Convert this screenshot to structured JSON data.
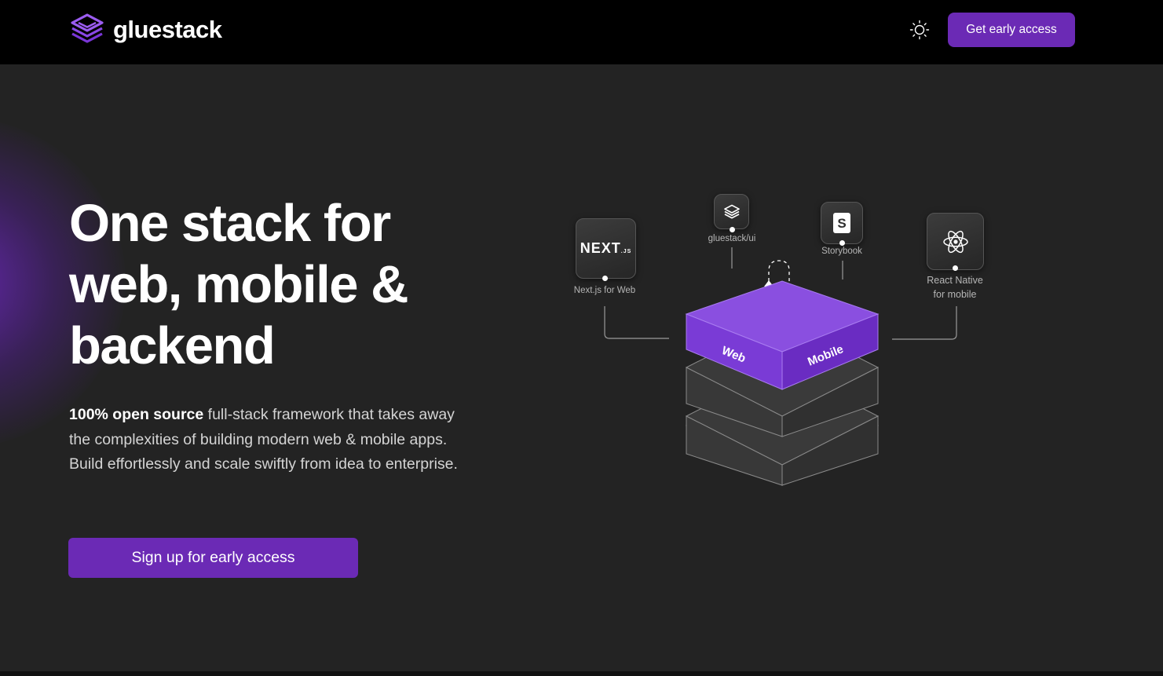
{
  "header": {
    "brand_name": "gluestack",
    "cta_label": "Get early access",
    "theme_icon": "sun-icon",
    "colors": {
      "background": "#000000",
      "accent": "#6b2ab5"
    }
  },
  "hero": {
    "headline_lines": [
      "One stack for",
      "web, mobile &",
      "backend"
    ],
    "description_bold": "100% open source",
    "description_rest": " full-stack framework that takes away the complexities of building modern web & mobile apps. Build effortlessly and scale swiftly from idea to enterprise.",
    "cta_label": "Sign up for early access"
  },
  "illustration": {
    "tiles": [
      {
        "id": "nextjs",
        "logo_text": "NEXT",
        "logo_sub": ".JS",
        "label": "Next.js for Web",
        "icon": "nextjs-logo-icon"
      },
      {
        "id": "gluestack-ui",
        "label": "gluestack/ui",
        "icon": "gluestack-logo-icon"
      },
      {
        "id": "storybook",
        "logo_text": "S",
        "label": "Storybook",
        "icon": "storybook-logo-icon"
      },
      {
        "id": "react-native",
        "label_lines": [
          "React Native",
          "for mobile"
        ],
        "icon": "react-logo-icon"
      }
    ],
    "cube_labels": {
      "left": "Web",
      "right": "Mobile"
    },
    "colors": {
      "top_layer": "#8a4fe0",
      "top_layer_side_left": "#7a3bd6",
      "top_layer_side_right": "#6a2cc2",
      "lower_layers": "#3a3a3a"
    }
  },
  "page": {
    "background": "#232323"
  }
}
